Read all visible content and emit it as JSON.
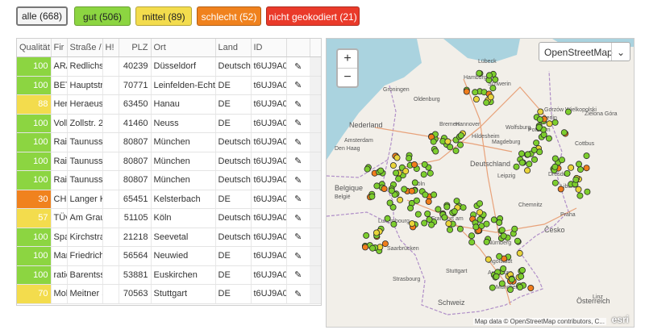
{
  "filters": [
    {
      "label": "alle (668)",
      "color": "#f4f4f4",
      "active": true
    },
    {
      "label": "gut (506)",
      "color": "#8cd541"
    },
    {
      "label": "mittel (89)",
      "color": "#f3dc4d"
    },
    {
      "label": "schlecht (52)",
      "color": "#f0821e"
    },
    {
      "label": "nicht geokodiert (21)",
      "color": "#ea3a2a"
    }
  ],
  "columns": [
    "Qualität",
    "Fir",
    "Straße / S",
    "H!",
    "PLZ",
    "Ort",
    "Land",
    "ID"
  ],
  "rows": [
    {
      "q": "100",
      "status": "gut",
      "firma": "ARA",
      "strasse": "Redlichstr.",
      "hnr": "",
      "plz": "40239",
      "ort": "Düsseldorf",
      "land": "Deutschla",
      "id": "t6UJ9A0C"
    },
    {
      "q": "100",
      "status": "gut",
      "firma": "BET",
      "strasse": "Hauptstra",
      "hnr": "",
      "plz": "70771",
      "ort": "Leinfelden-Echterdi",
      "land": "DE",
      "id": "t6UJ9A0C"
    },
    {
      "q": "88",
      "status": "mittel",
      "firma": "Her",
      "strasse": "Heraeusst",
      "hnr": "",
      "plz": "63450",
      "ort": "Hanau",
      "land": "DE",
      "id": "t6UJ9A0C"
    },
    {
      "q": "100",
      "status": "gut",
      "firma": "Volk",
      "strasse": "Zollstr. 2",
      "hnr": "",
      "plz": "41460",
      "ort": "Neuss",
      "land": "DE",
      "id": "t6UJ9A0C"
    },
    {
      "q": "100",
      "status": "gut",
      "firma": "Raif",
      "strasse": "Taunusstr.",
      "hnr": "",
      "plz": "80807",
      "ort": "München",
      "land": "Deutschla",
      "id": "t6UJ9A0C"
    },
    {
      "q": "100",
      "status": "gut",
      "firma": "Raif",
      "strasse": "Taunusstr.",
      "hnr": "",
      "plz": "80807",
      "ort": "München",
      "land": "Deutschla",
      "id": "t6UJ9A0C"
    },
    {
      "q": "100",
      "status": "gut",
      "firma": "Raif",
      "strasse": "Taunusstr.",
      "hnr": "",
      "plz": "80807",
      "ort": "München",
      "land": "Deutschla",
      "id": "t6UJ9A0C"
    },
    {
      "q": "30",
      "status": "schlecht",
      "firma": "CHC",
      "strasse": "Langer Ko",
      "hnr": "",
      "plz": "65451",
      "ort": "Kelsterbach",
      "land": "DE",
      "id": "t6UJ9A0C"
    },
    {
      "q": "57",
      "status": "mittel",
      "firma": "TÜv",
      "strasse": "Am Grauer",
      "hnr": "",
      "plz": "51105",
      "ort": "Köln",
      "land": "Deutschla",
      "id": "t6UJ9A0C"
    },
    {
      "q": "100",
      "status": "gut",
      "firma": "Spa",
      "strasse": "Kirchstras",
      "hnr": "",
      "plz": "21218",
      "ort": "Seevetal",
      "land": "Deutschla",
      "id": "t6UJ9A0C"
    },
    {
      "q": "100",
      "status": "gut",
      "firma": "Mar",
      "strasse": "Friedrich-E",
      "hnr": "",
      "plz": "56564",
      "ort": "Neuwied",
      "land": "DE",
      "id": "t6UJ9A0C"
    },
    {
      "q": "100",
      "status": "gut",
      "firma": "ratio",
      "strasse": "Barentsstr",
      "hnr": "",
      "plz": "53881",
      "ort": "Euskirchen",
      "land": "DE",
      "id": "t6UJ9A0C"
    },
    {
      "q": "70",
      "status": "mittel",
      "firma": "Mob",
      "strasse": "Meitner St",
      "hnr": "",
      "plz": "70563",
      "ort": "Stuttgart",
      "land": "DE",
      "id": "t6UJ9A0C"
    }
  ],
  "edit_icon": "pencil-icon",
  "map": {
    "zoom_in": "+",
    "zoom_out": "−",
    "layer": "OpenStreetMap",
    "attribution": "Map data © OpenStreetMap contributors, C...",
    "logo": "esri",
    "labels": [
      {
        "name": "Groningen"
      },
      {
        "name": "Oldenburg"
      },
      {
        "name": "Hamburg"
      },
      {
        "name": "Lübeck"
      },
      {
        "name": "Schwerin"
      },
      {
        "name": "Nederland"
      },
      {
        "name": "Den Haag"
      },
      {
        "name": "Amsterdam"
      },
      {
        "name": "Bremen"
      },
      {
        "name": "Hannover"
      },
      {
        "name": "Wolfsburg"
      },
      {
        "name": "Berlin"
      },
      {
        "name": "Potsdam"
      },
      {
        "name": "Magdeburg"
      },
      {
        "name": "Deutschland"
      },
      {
        "name": "Belgique"
      },
      {
        "name": "België"
      },
      {
        "name": "Köln"
      },
      {
        "name": "Leipzig"
      },
      {
        "name": "Dresden"
      },
      {
        "name": "Chemnitz"
      },
      {
        "name": "Praha"
      },
      {
        "name": "Luxembourg"
      },
      {
        "name": "Frankfurt am"
      },
      {
        "name": "Nürnberg"
      },
      {
        "name": "Česko"
      },
      {
        "name": "Saarbrücken"
      },
      {
        "name": "Strasbourg"
      },
      {
        "name": "Stuttgart"
      },
      {
        "name": "Ingolstadt"
      },
      {
        "name": "Augsburg"
      },
      {
        "name": "München"
      },
      {
        "name": "Linz"
      },
      {
        "name": "Schweiz"
      },
      {
        "name": "Österreich"
      },
      {
        "name": "Liberec"
      },
      {
        "name": "Cottbus"
      },
      {
        "name": "Gorzów Wielkopolski"
      },
      {
        "name": "Zielona Góra"
      },
      {
        "name": "Hildesheim"
      }
    ]
  }
}
